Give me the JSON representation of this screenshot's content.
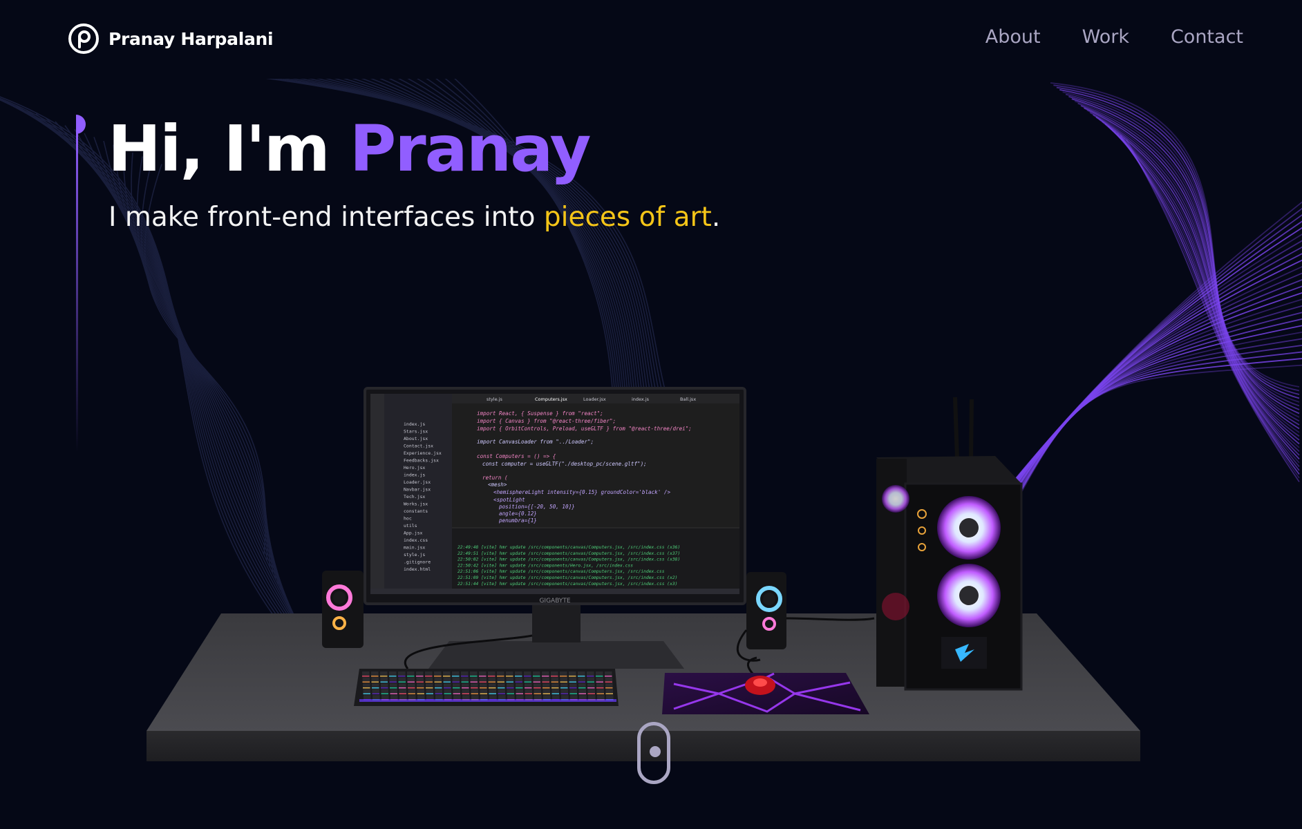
{
  "header": {
    "brand_name": "Pranay Harpalani",
    "logo_letter": "p",
    "nav": [
      {
        "label": "About"
      },
      {
        "label": "Work"
      },
      {
        "label": "Contact"
      }
    ]
  },
  "hero": {
    "title_prefix": "Hi, I'm ",
    "title_name": "Pranay",
    "subtitle_before": "I make front-end interfaces into ",
    "subtitle_highlight": "pieces of art",
    "subtitle_after": "."
  },
  "scene": {
    "monitor_brand": "GIGABYTE",
    "editor_tabs": [
      "style.js",
      "Computers.jsx",
      "Loader.jsx",
      "index.js",
      "Ball.jsx"
    ],
    "code_lines": [
      "import React, { Suspense } from \"react\";",
      "import { Canvas } from \"@react-three/fiber\";",
      "import { OrbitControls, Preload, useGLTF } from \"@react-three/drei\";",
      "import CanvasLoader from \"../Loader\";",
      "const Computers = () => {",
      "  const computer = useGLTF(\"./desktop_pc/scene.gltf\");",
      "  return (",
      "    <mesh>",
      "      <hemisphereLight intensity={0.15} groundColor='black' />",
      "      <spotLight",
      "        position={[-20, 50, 10]}",
      "        angle={0.12}",
      "        penumbra={1}"
    ],
    "terminal_lines": [
      "22:49:48 [vite] hmr update /src/components/canvas/Computers.jsx, /src/index.css (x36)",
      "22:49:51 [vite] hmr update /src/components/canvas/Computers.jsx, /src/index.css (x37)",
      "22:50:02 [vite] hmr update /src/components/canvas/Computers.jsx, /src/index.css (x38)",
      "22:50:42 [vite] hmr update /src/components/Hero.jsx, /src/index.css",
      "22:51:06 [vite] hmr update /src/components/canvas/Computers.jsx, /src/index.css",
      "22:51:09 [vite] hmr update /src/components/canvas/Computers.jsx, /src/index.css (x2)",
      "22:51:44 [vite] hmr update /src/components/canvas/Computers.jsx, /src/index.css (x3)"
    ],
    "explorer_files": [
      "index.js",
      "Stars.jsx",
      "About.jsx",
      "Contact.jsx",
      "Experience.jsx",
      "Feedbacks.jsx",
      "Hero.jsx",
      "index.js",
      "Loader.jsx",
      "Navbar.jsx",
      "Tech.jsx",
      "Works.jsx",
      "constants",
      "hoc",
      "utils",
      "App.jsx",
      "index.css",
      "main.jsx",
      "style.js",
      ".gitignore",
      "index.html"
    ]
  },
  "colors": {
    "background": "#050816",
    "accent_purple": "#915eff",
    "highlight_yellow": "#f5c518",
    "nav_text": "#aaa6c3"
  }
}
